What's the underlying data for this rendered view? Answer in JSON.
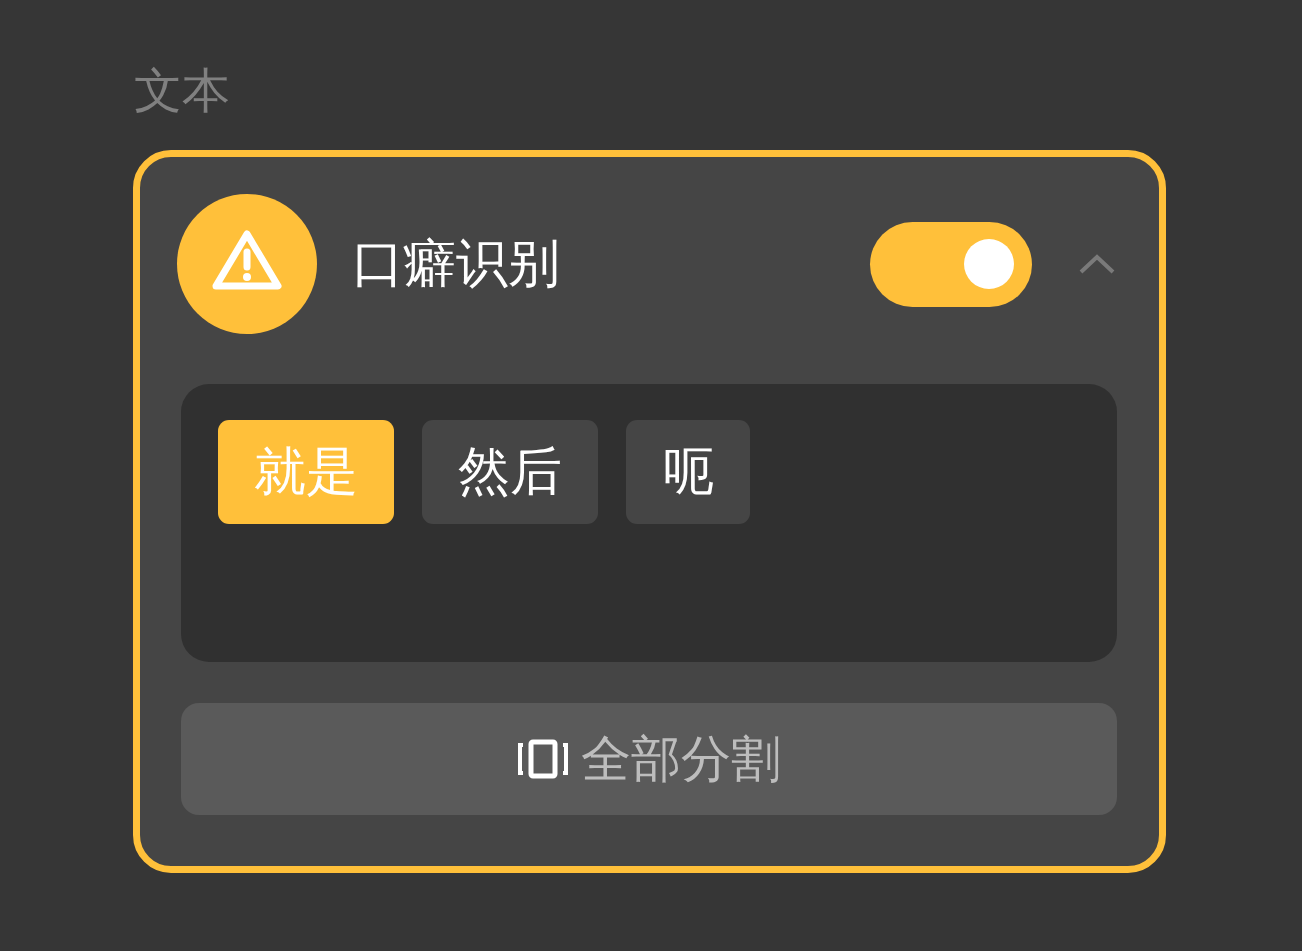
{
  "section_title": "文本",
  "card": {
    "title": "口癖识别",
    "on": true,
    "expanded": true,
    "chips": [
      {
        "label": "就是",
        "selected": true
      },
      {
        "label": "然后",
        "selected": false
      },
      {
        "label": "呃",
        "selected": false
      }
    ],
    "action_button": {
      "label": "全部分割"
    }
  }
}
